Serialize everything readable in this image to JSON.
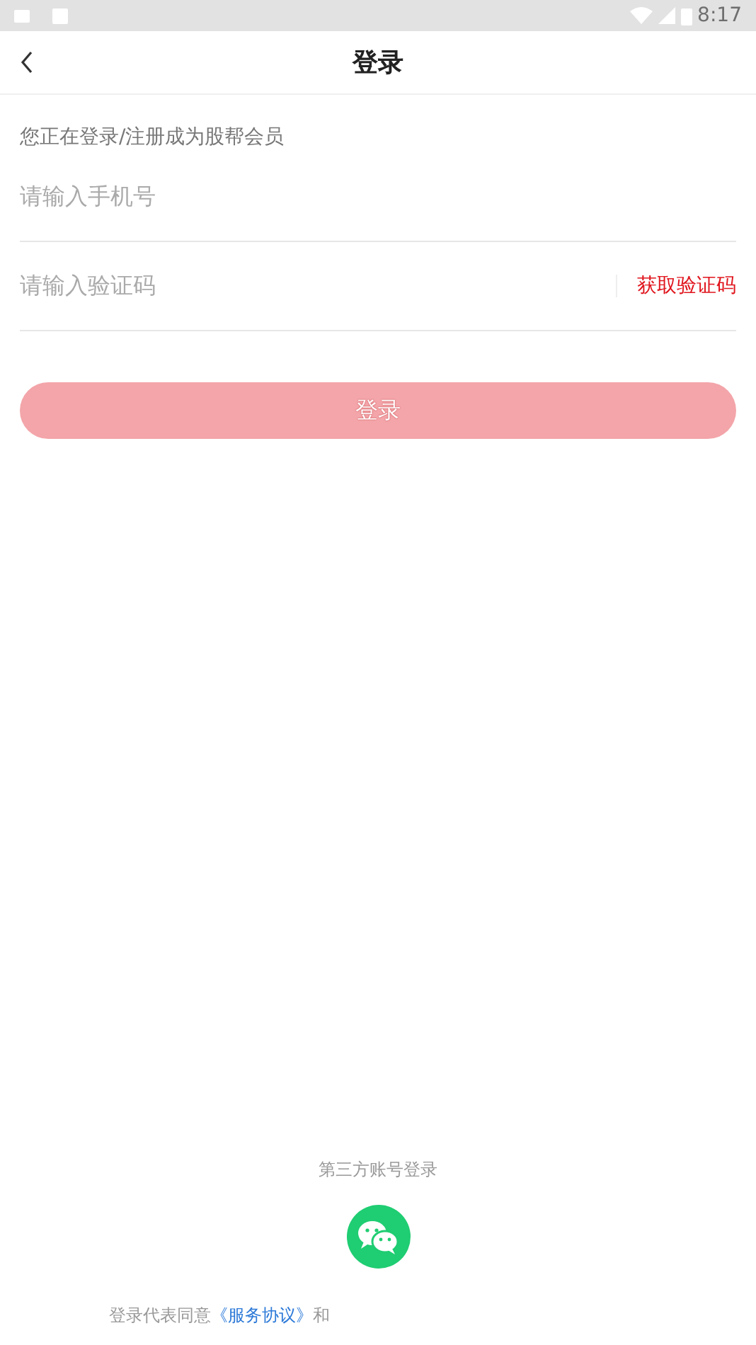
{
  "status_bar": {
    "time": "8:17"
  },
  "header": {
    "title": "登录"
  },
  "intro": "您正在登录/注册成为股帮会员",
  "phone_field": {
    "placeholder": "请输入手机号"
  },
  "code_field": {
    "placeholder": "请输入验证码",
    "action": "获取验证码"
  },
  "login_button": {
    "label": "登录",
    "disabled": true
  },
  "third_party": {
    "label": "第三方账号登录"
  },
  "agreement": {
    "prefix": "登录代表同意",
    "link": "《服务协议》",
    "joiner": "和"
  }
}
